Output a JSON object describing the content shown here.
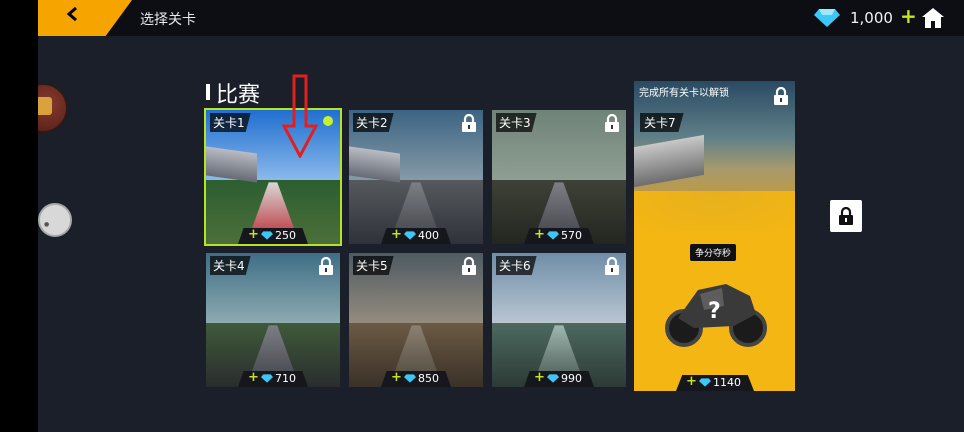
{
  "header": {
    "title": "选择关卡",
    "currency": "1,000",
    "plus": "+"
  },
  "section": {
    "title": "比赛"
  },
  "levels": [
    {
      "label": "关卡1",
      "reward": "250",
      "locked": false,
      "selected": true
    },
    {
      "label": "关卡2",
      "reward": "400",
      "locked": true
    },
    {
      "label": "关卡3",
      "reward": "570",
      "locked": true
    },
    {
      "label": "关卡4",
      "reward": "710",
      "locked": true
    },
    {
      "label": "关卡5",
      "reward": "850",
      "locked": true
    },
    {
      "label": "关卡6",
      "reward": "990",
      "locked": true
    }
  ],
  "special_level": {
    "unlock_text": "完成所有关卡以解锁",
    "label": "关卡7",
    "mode": "争分夺秒",
    "reward": "1140",
    "locked": true
  },
  "colors": {
    "accent": "#f5a400",
    "selection": "#b4e32a",
    "plus": "#c7e21e",
    "gem": "#3ec7f5",
    "panel": "#1a1f2a"
  },
  "icons": {
    "back": "chevron-left-icon",
    "gem": "diamond-icon",
    "home": "home-icon",
    "lock": "lock-icon",
    "arrow": "down-arrow-icon"
  }
}
